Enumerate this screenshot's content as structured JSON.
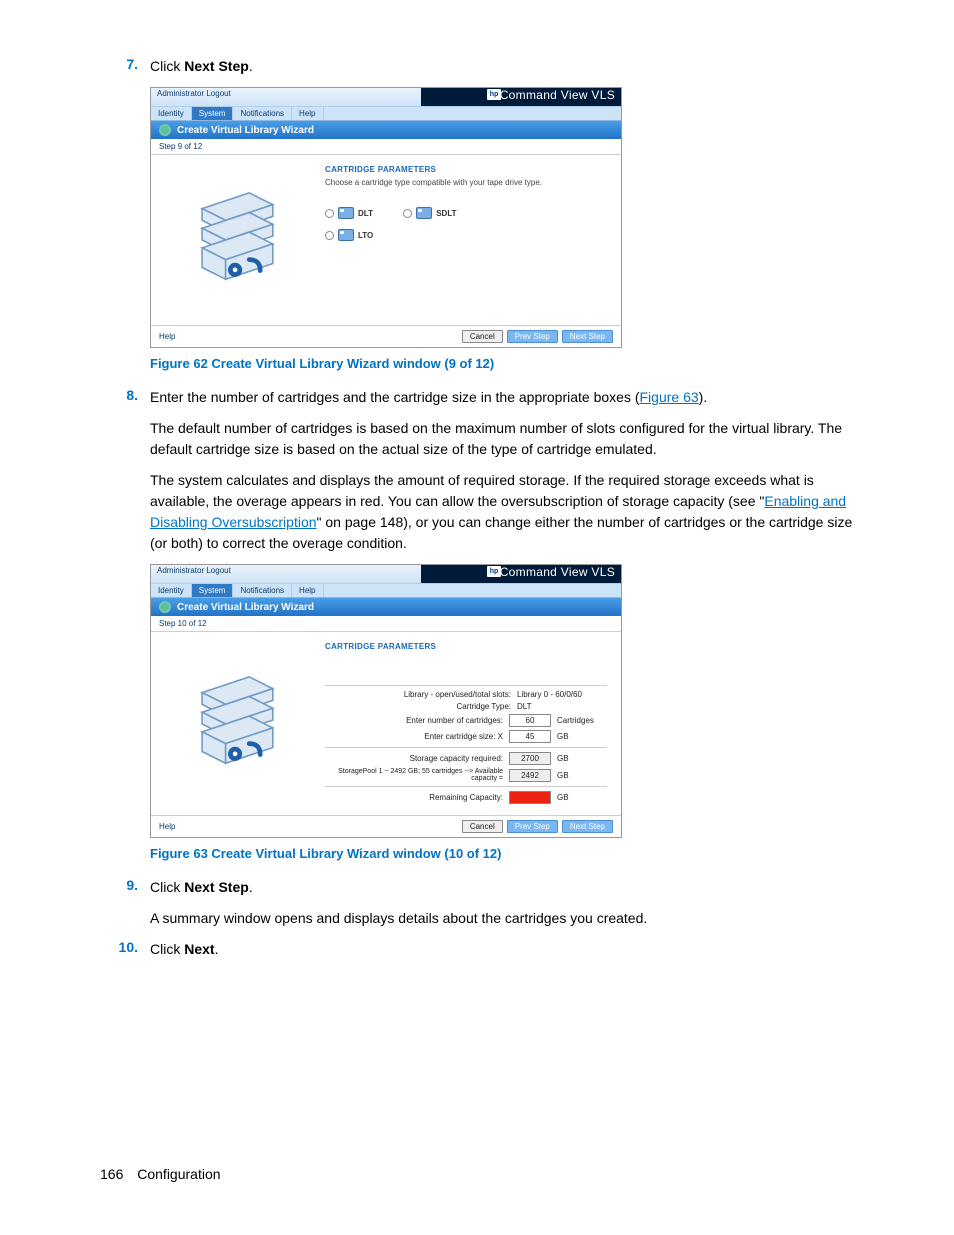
{
  "steps": {
    "s7_num": "7.",
    "s7_p1a": "Click ",
    "s7_p1b": "Next Step",
    "s7_p1c": ".",
    "s8_num": "8.",
    "s8_p1a": "Enter the number of cartridges and the cartridge size in the appropriate boxes (",
    "s8_link": "Figure 63",
    "s8_p1b": ").",
    "s8_p2": "The default number of cartridges is based on the maximum number of slots configured for the virtual library. The default cartridge size is based on the actual size of the type of cartridge emulated.",
    "s8_p3a": "The system calculates and displays the amount of required storage. If the required storage exceeds what is available, the overage appears in red. You can allow the oversubscription of storage capacity (see \"",
    "s8_link2": "Enabling and Disabling Oversubscription",
    "s8_p3b": "\" on page 148), or you can change either the number of cartridges or the cartridge size (or both) to correct the overage condition.",
    "s9_num": "9.",
    "s9_p1a": "Click ",
    "s9_p1b": "Next Step",
    "s9_p1c": ".",
    "s9_p2": "A summary window opens and displays details about the cartridges you created.",
    "s10_num": "10.",
    "s10_p1a": "Click ",
    "s10_p1b": "Next",
    "s10_p1c": "."
  },
  "captions": {
    "fig62": "Figure 62 Create Virtual Library Wizard window (9 of 12)",
    "fig63": "Figure 63 Create Virtual Library Wizard window (10 of 12)"
  },
  "footer": {
    "page": "166",
    "section": "Configuration"
  },
  "common_ui": {
    "admin_logout": "Administrator  Logout",
    "brand": "Command View VLS",
    "hp": "hp",
    "tabs": {
      "identity": "Identity",
      "system": "System",
      "notifications": "Notifications",
      "help": "Help"
    },
    "wizard_title": "Create Virtual Library Wizard",
    "help": "Help",
    "cancel": "Cancel",
    "prev": "Prev Step",
    "next": "Next Step"
  },
  "fig62": {
    "step": "Step 9 of 12",
    "sec": "CARTRIDGE PARAMETERS",
    "sub": "Choose a cartridge type compatible with your tape drive type.",
    "opt_dlt": "DLT",
    "opt_sdlt": "SDLT",
    "opt_lto": "LTO"
  },
  "fig63": {
    "step": "Step 10 of 12",
    "sec": "CARTRIDGE PARAMETERS",
    "rows": {
      "slots_lbl": "Library - open/used/total slots:",
      "slots_val": "Library 0 - 60/0/60",
      "type_lbl": "Cartridge Type:",
      "type_val": "DLT",
      "num_lbl": "Enter number of cartridges:",
      "num_val": "60",
      "num_unit": "Cartridges",
      "size_lbl": "Enter cartridge size: X",
      "size_val": "45",
      "size_unit": "GB",
      "req_lbl": "Storage capacity required:",
      "req_val": "2700",
      "req_unit": "GB",
      "pool_lbl": "StoragePool 1 ~ 2492  GB; 55 cartridges --> Available capacity =",
      "pool_val": "2492",
      "pool_unit": "GB",
      "rem_lbl": "Remaining Capacity:",
      "rem_unit": "GB"
    }
  }
}
